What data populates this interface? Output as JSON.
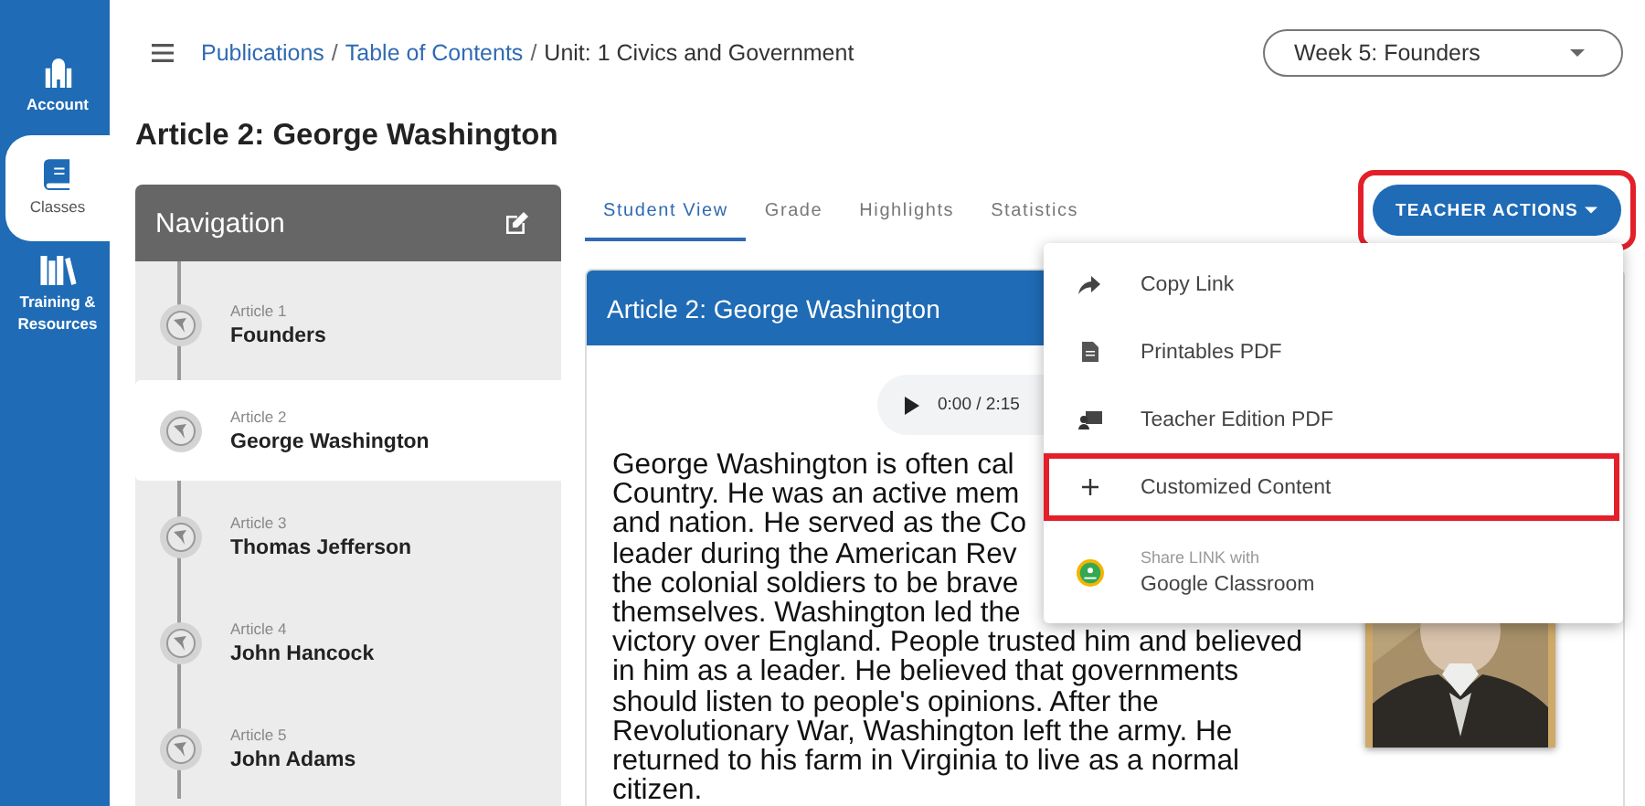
{
  "sidebar": {
    "items": [
      {
        "label": "Account",
        "selected": false
      },
      {
        "label": "Classes",
        "selected": true
      },
      {
        "label": "Training & Resources",
        "selected": false
      }
    ]
  },
  "breadcrumb": [
    {
      "kind": "link",
      "text": "Publications"
    },
    {
      "kind": "separator",
      "text": "/"
    },
    {
      "kind": "link",
      "text": "Table of Contents"
    },
    {
      "kind": "separator",
      "text": "/"
    },
    {
      "kind": "current",
      "text": "Unit: 1 Civics and Government"
    }
  ],
  "week_select": {
    "value": "Week 5: Founders"
  },
  "page_title": "Article 2: George Washington",
  "navigation": {
    "title": "Navigation",
    "items": [
      {
        "number": "Article 1",
        "title": "Founders",
        "selected": false
      },
      {
        "number": "Article 2",
        "title": "George Washington",
        "selected": true
      },
      {
        "number": "Article 3",
        "title": "Thomas Jefferson",
        "selected": false
      },
      {
        "number": "Article 4",
        "title": "John Hancock",
        "selected": false
      },
      {
        "number": "Article 5",
        "title": "John Adams",
        "selected": false
      }
    ]
  },
  "tabs": [
    {
      "label": "Student View",
      "selected": true
    },
    {
      "label": "Grade",
      "selected": false
    },
    {
      "label": "Highlights",
      "selected": false
    },
    {
      "label": "Statistics",
      "selected": false
    }
  ],
  "teacher_actions": {
    "label": "TEACHER ACTIONS",
    "highlighted": true
  },
  "article": {
    "title": "Article 2: George Washington",
    "audio_time": "0:00 / 2:15",
    "lines": [
      "George Washington is often cal",
      "Country. He was an active mem",
      "and nation. He served as the Co",
      "leader during the American Rev",
      "the colonial soldiers to be brave",
      "themselves. Washington led the",
      "victory over England. People trusted him and believed",
      "in him as a leader. He believed that governments",
      "should listen to people's opinions. After the",
      "Revolutionary War, Washington left the army. He",
      "returned to his farm in Virginia to live as a normal",
      "citizen."
    ]
  },
  "menu": {
    "items": [
      {
        "kind": "share",
        "label": "Copy Link",
        "highlighted": false
      },
      {
        "kind": "file",
        "label": "Printables PDF",
        "highlighted": false
      },
      {
        "kind": "teacher",
        "label": "Teacher Edition PDF",
        "highlighted": false
      },
      {
        "kind": "plus",
        "label": "Customized Content",
        "highlighted": true
      },
      {
        "kind": "classroom",
        "caption": "Share LINK with",
        "label": "Google Classroom",
        "highlighted": false
      }
    ]
  }
}
